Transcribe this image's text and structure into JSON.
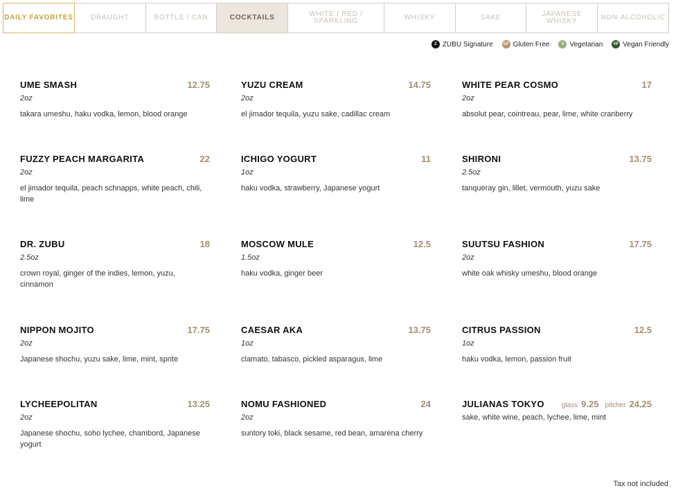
{
  "tabs": [
    {
      "label": "DAILY FAVORITES",
      "state": "highlight"
    },
    {
      "label": "DRAUGHT",
      "state": "normal"
    },
    {
      "label": "BOTTLE / CAN",
      "state": "normal"
    },
    {
      "label": "COCKTAILS",
      "state": "selected"
    },
    {
      "label": "WHITE / RED / SPARKLING",
      "state": "normal"
    },
    {
      "label": "WHISKY",
      "state": "normal"
    },
    {
      "label": "SAKE",
      "state": "normal"
    },
    {
      "label": "JAPANESE WHISKY",
      "state": "normal"
    },
    {
      "label": "NON-ALCOHOLIC",
      "state": "normal"
    }
  ],
  "legend": [
    {
      "abbr": "Z",
      "label": "ZUBU Signature",
      "icon": "zubu-signature-icon",
      "color": "#111111"
    },
    {
      "abbr": "GF",
      "label": "Gluten Free",
      "icon": "gluten-free-icon",
      "color": "#b8906a"
    },
    {
      "abbr": "V",
      "label": "Vegetarian",
      "icon": "vegetarian-icon",
      "color": "#8fb27a"
    },
    {
      "abbr": "VF",
      "label": "Vegan Friendly",
      "icon": "vegan-friendly-icon",
      "color": "#2f5a2c"
    }
  ],
  "menu": [
    {
      "name": "UME SMASH",
      "price": "12.75",
      "size": "2oz",
      "description": "takara umeshu, haku vodka, lemon, blood orange"
    },
    {
      "name": "YUZU CREAM",
      "price": "14.75",
      "size": "2oz",
      "description": "el jimador tequila, yuzu sake, cadillac cream"
    },
    {
      "name": "WHITE PEAR COSMO",
      "price": "17",
      "size": "2oz",
      "description": "absolut pear, cointreau, pear, lime, white cranberry"
    },
    {
      "name": "FUZZY PEACH MARGARITA",
      "price": "22",
      "size": "2oz",
      "description": "el jimador tequila, peach schnapps, white peach, chili, lime"
    },
    {
      "name": "ICHIGO YOGURT",
      "price": "11",
      "size": "1oz",
      "description": "haku vodka, strawberry, Japanese yogurt"
    },
    {
      "name": "SHIRONI",
      "price": "13.75",
      "size": "2.5oz",
      "description": "tanqueray gin, lillet, vermouth, yuzu sake"
    },
    {
      "name": "DR. ZUBU",
      "price": "18",
      "size": "2.5oz",
      "description": "crown royal, ginger of the indies, lemon, yuzu, cinnamon"
    },
    {
      "name": "MOSCOW MULE",
      "price": "12.5",
      "size": "1.5oz",
      "description": "haku vodka, ginger beer"
    },
    {
      "name": "SUUTSU FASHION",
      "price": "17.75",
      "size": "2oz",
      "description": "white oak whisky umeshu, blood orange"
    },
    {
      "name": "NIPPON MOJITO",
      "price": "17.75",
      "size": "2oz",
      "description": "Japanese shochu, yuzu sake, lime, mint, sprite"
    },
    {
      "name": "CAESAR AKA",
      "price": "13.75",
      "size": "1oz",
      "description": "clamato, tabasco, pickled asparagus, lime"
    },
    {
      "name": "CITRUS PASSION",
      "price": "12.5",
      "size": "1oz",
      "description": "haku vodka, lemon, passion fruit"
    },
    {
      "name": "LYCHEEPOLITAN",
      "price": "13.25",
      "size": "2oz",
      "description": "Japanese shochu, soho lychee, chambord, Japanese yogurt"
    },
    {
      "name": "NOMU FASHIONED",
      "price": "24",
      "size": "2oz",
      "description": "suntory toki, black sesame, red bean, amarena cherry"
    },
    {
      "name": "JULIANAS TOKYO",
      "glass_label": "glass",
      "glass_price": "9.25",
      "pitcher_label": "pitcher",
      "pitcher_price": "24.25",
      "description": "sake, white wine, peach, lychee, lime, mint"
    }
  ],
  "footer": {
    "tax_note": "Tax not included"
  }
}
